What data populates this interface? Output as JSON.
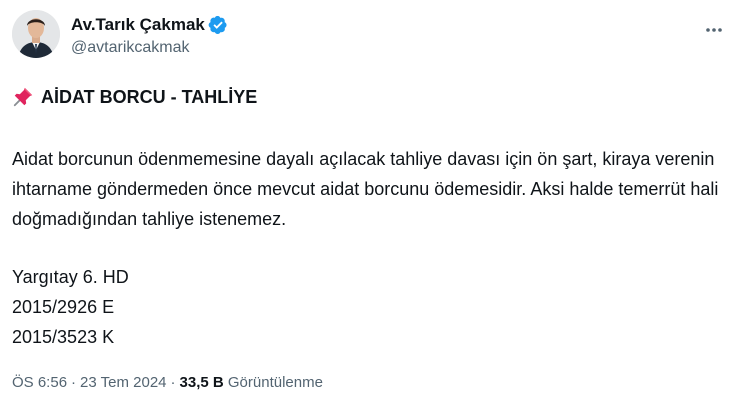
{
  "author": {
    "display_name": "Av.Tarık Çakmak",
    "handle": "@avtarikcakmak",
    "verified": true,
    "verified_color": "#1d9bf0"
  },
  "post": {
    "title": "AİDAT BORCU - TAHLİYE",
    "title_icon": "pushpin-icon",
    "body": "Aidat borcunun ödenmemesine dayalı açılacak tahliye davası için ön şart, kiraya verenin ihtarname göndermeden önce mevcut aidat borcunu ödemesidir. Aksi halde temerrüt hali doğmadığından tahliye istenemez.",
    "reference_lines": [
      "Yargıtay 6. HD",
      "2015/2926 E",
      "2015/3523 K"
    ]
  },
  "meta": {
    "time": "ÖS 6:56",
    "separator": "·",
    "date": "23 Tem 2024",
    "views_count": "33,5 B",
    "views_label": "Görüntülenme"
  },
  "colors": {
    "text": "#0f1419",
    "secondary": "#536471",
    "accent": "#1d9bf0"
  }
}
